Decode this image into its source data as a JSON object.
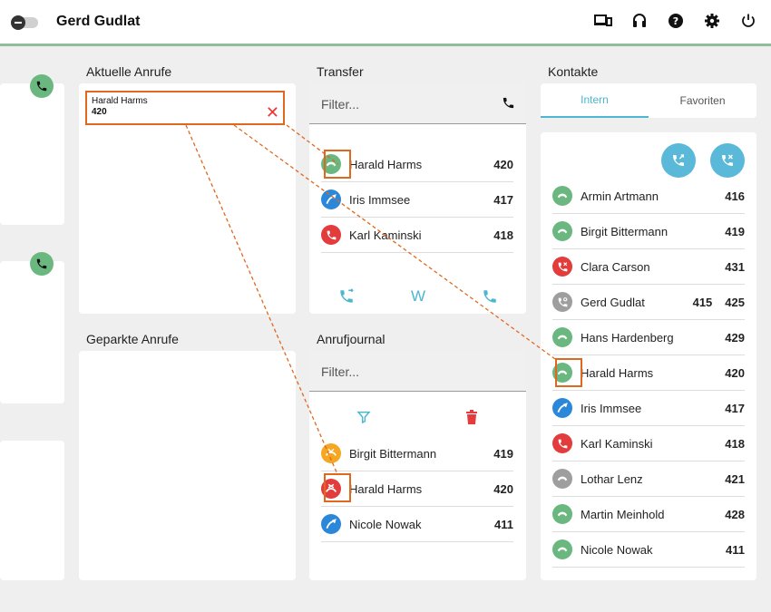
{
  "header": {
    "user_name": "Gerd Gudlat"
  },
  "sections": {
    "aktuelle_anrufe": "Aktuelle Anrufe",
    "geparkte_anrufe": "Geparkte Anrufe",
    "transfer": "Transfer",
    "anrufjournal": "Anrufjournal",
    "kontakte": "Kontakte"
  },
  "current_call": {
    "name": "Harald Harms",
    "number": "420",
    "close_icon": "close-icon"
  },
  "transfer": {
    "filter_placeholder": "Filter...",
    "rows": [
      {
        "name": "Harald Harms",
        "number": "420",
        "status": "connected"
      },
      {
        "name": "Iris Immsee",
        "number": "417",
        "status": "incoming"
      },
      {
        "name": "Karl Kaminski",
        "number": "418",
        "status": "busy"
      }
    ],
    "actions": {
      "w_label": "W"
    }
  },
  "journal": {
    "filter_placeholder": "Filter...",
    "rows": [
      {
        "name": "Birgit Bittermann",
        "number": "419",
        "status": "missed"
      },
      {
        "name": "Harald Harms",
        "number": "420",
        "status": "rejected"
      },
      {
        "name": "Nicole Nowak",
        "number": "411",
        "status": "incoming"
      }
    ]
  },
  "contacts": {
    "tabs": [
      "Intern",
      "Favoriten"
    ],
    "active_tab": "Intern",
    "rows": [
      {
        "name": "Armin Artmann",
        "number": "416",
        "status": "available"
      },
      {
        "name": "Birgit Bittermann",
        "number": "419",
        "status": "available"
      },
      {
        "name": "Clara Carson",
        "number": "431",
        "status": "dnd"
      },
      {
        "name": "Gerd Gudlat",
        "number": "415",
        "number2": "425",
        "status": "self"
      },
      {
        "name": "Hans Hardenberg",
        "number": "429",
        "status": "available"
      },
      {
        "name": "Harald Harms",
        "number": "420",
        "status": "available"
      },
      {
        "name": "Iris Immsee",
        "number": "417",
        "status": "incoming"
      },
      {
        "name": "Karl Kaminski",
        "number": "418",
        "status": "busy"
      },
      {
        "name": "Lothar Lenz",
        "number": "421",
        "status": "offline"
      },
      {
        "name": "Martin Meinhold",
        "number": "428",
        "status": "available"
      },
      {
        "name": "Nicole Nowak",
        "number": "411",
        "status": "available"
      }
    ]
  },
  "colors": {
    "green": "#6ab87f",
    "blue": "#2b87d8",
    "red": "#e33c3c",
    "orange": "#f5a623",
    "gray": "#9e9e9e",
    "accent": "#4db6d0",
    "highlight": "#e0681e"
  }
}
